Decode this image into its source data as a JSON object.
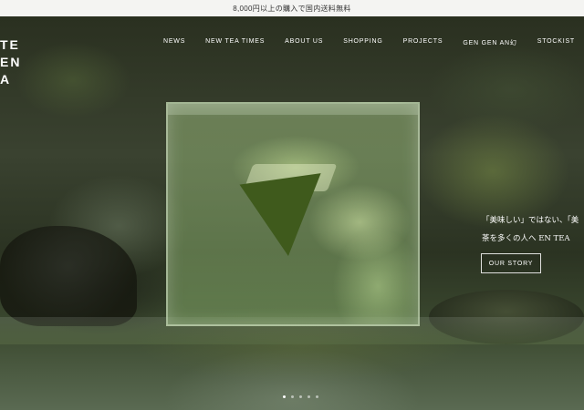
{
  "announcement": {
    "text": "8,000円以上の購入で国内送料無料"
  },
  "logo": {
    "lines": [
      "TE",
      "EN",
      "A"
    ]
  },
  "nav": {
    "items": [
      {
        "label": "NEWS"
      },
      {
        "label": "NEW TEA TIMES"
      },
      {
        "label": "ABOUT US"
      },
      {
        "label": "SHOPPING"
      },
      {
        "label": "PROJECTS"
      },
      {
        "label": "GEN GEN AN幻"
      },
      {
        "label": "STOCKIST"
      }
    ]
  },
  "hero": {
    "copy_line1": "「美味しい」ではない、「美",
    "copy_line2": "茶を多くの人へ EN TEA",
    "cta_label": "OUR STORY",
    "slides_total": 5,
    "slide_active": 1
  },
  "colors": {
    "announce_bg": "#f4f4f2",
    "text_light": "#ffffff"
  }
}
